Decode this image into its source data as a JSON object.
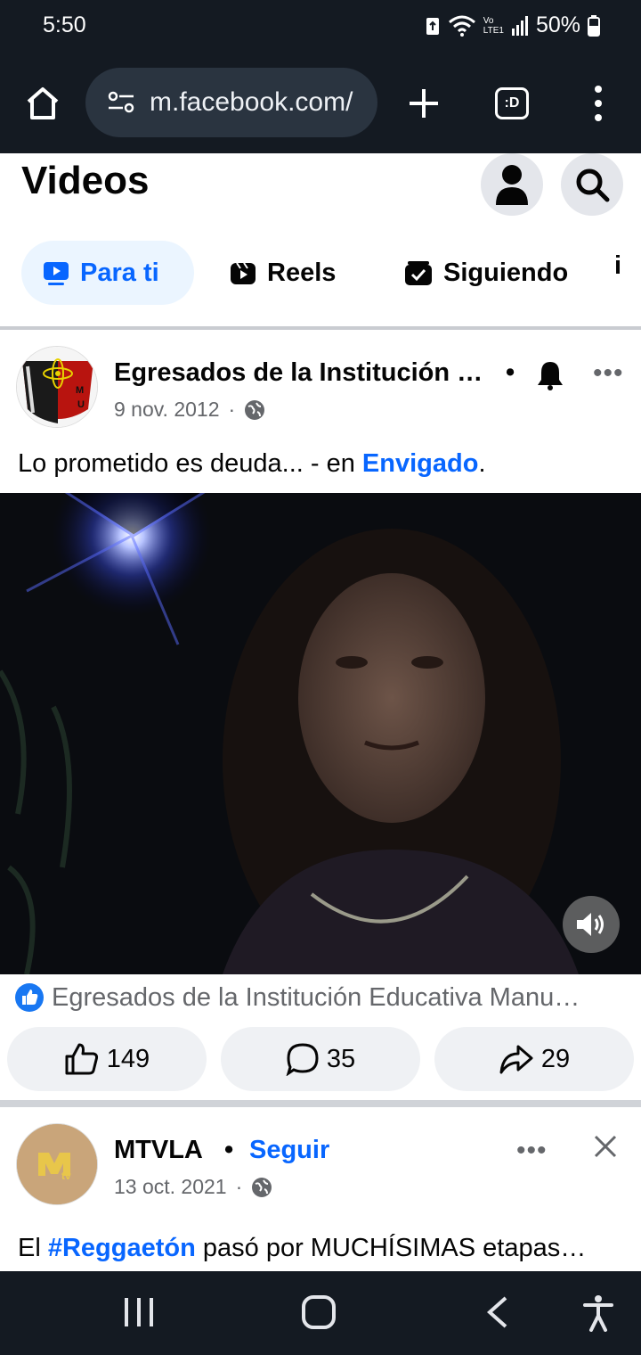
{
  "status_bar": {
    "time": "5:50",
    "network": "LTE1",
    "carrier_label": "Vo",
    "battery": "50%"
  },
  "browser": {
    "url": "m.facebook.com/",
    "tabs_label": ":D"
  },
  "videos_page": {
    "title": "Videos",
    "tabs": [
      {
        "label": "Para ti",
        "active": true,
        "icon": "play-icon"
      },
      {
        "label": "Reels",
        "active": false,
        "icon": "reels-icon"
      },
      {
        "label": "Siguiendo",
        "active": false,
        "icon": "following-icon"
      }
    ]
  },
  "post1": {
    "author": "Egresados de la Institución …",
    "date": "9 nov. 2012",
    "text_prefix": "Lo prometido es deuda... - en ",
    "text_link": "Envigado",
    "text_suffix": ".",
    "source": "Egresados de la Institución Educativa Manu…",
    "likes": "149",
    "comments": "35",
    "shares": "29",
    "avatar_letters": "M U"
  },
  "post2": {
    "author": "MTVLA",
    "follow_label": "Seguir",
    "date": "13 oct. 2021",
    "text_prefix": "El ",
    "text_hashtag": "#Reggaetón",
    "text_suffix": " pasó por MUCHÍSIMAS etapas…"
  },
  "colors": {
    "accent": "#0866ff",
    "dark_bar": "#141a22",
    "button_bg": "#eff1f4"
  }
}
